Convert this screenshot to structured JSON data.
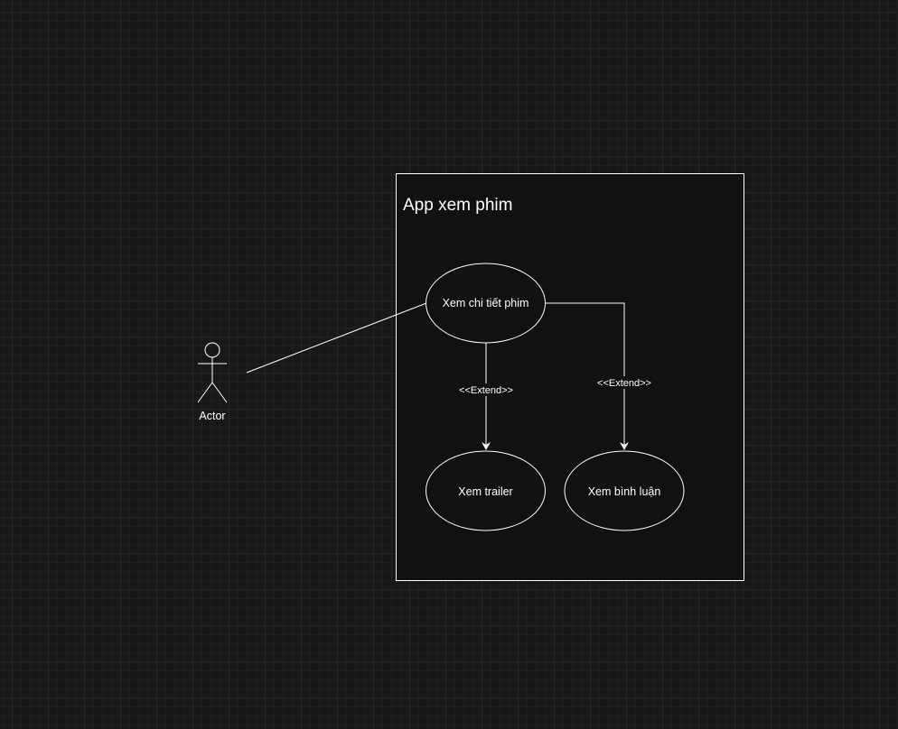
{
  "system": {
    "title": "App xem phim"
  },
  "actor": {
    "label": "Actor"
  },
  "use_cases": {
    "details": "Xem chi tiết phim",
    "trailer": "Xem trailer",
    "reviews": "Xem bình luận"
  },
  "relations": {
    "extend_trailer": "<<Extend>>",
    "extend_reviews": "<<Extend>>"
  },
  "colors": {
    "background": "#181818",
    "system_fill": "#111111",
    "stroke": "#ffffff",
    "text": "#ffffff"
  }
}
